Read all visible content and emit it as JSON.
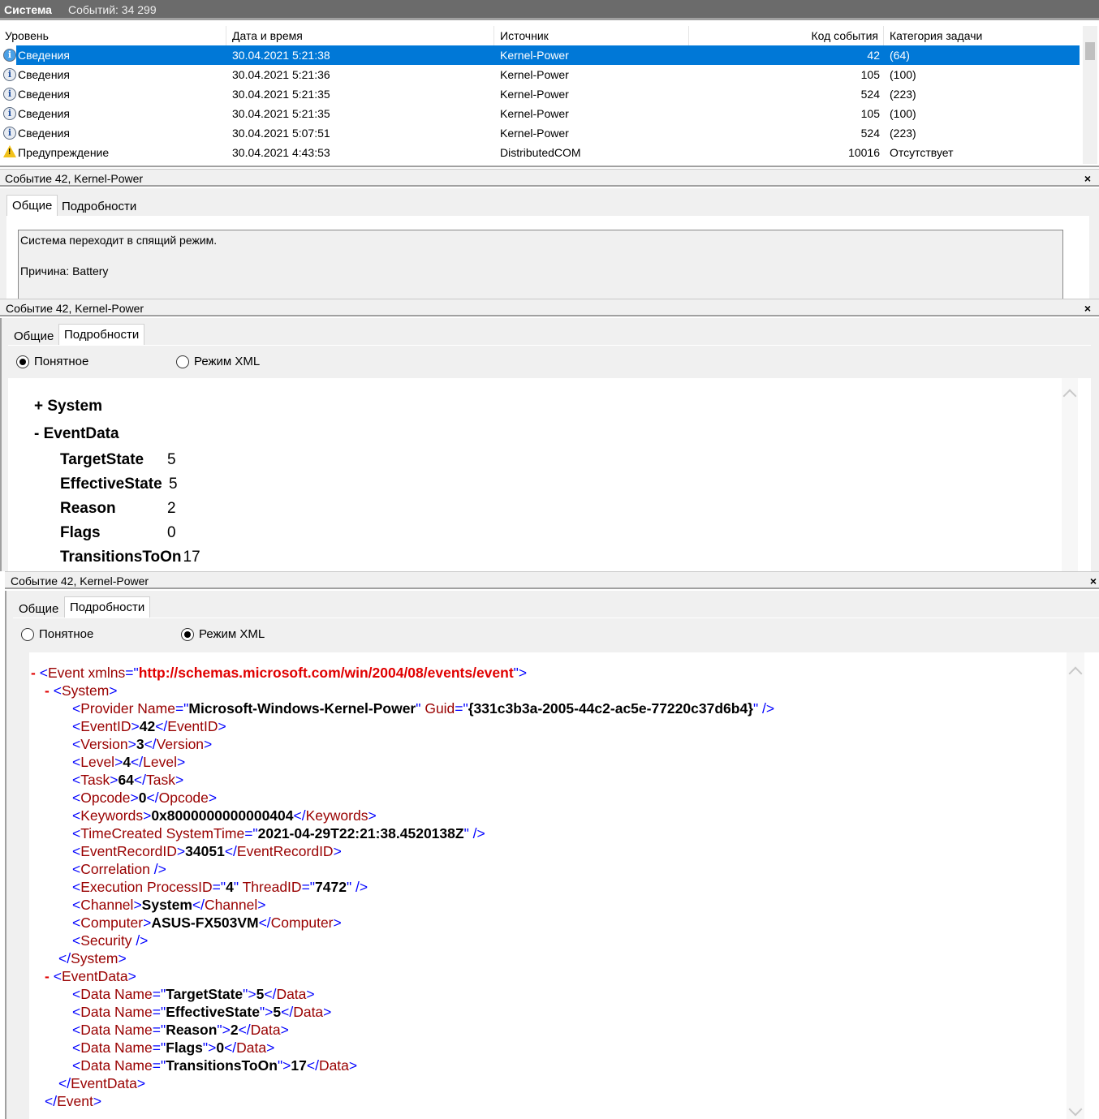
{
  "topbar": {
    "log_name": "Система",
    "event_count": "Событий: 34 299"
  },
  "grid": {
    "columns": [
      "Уровень",
      "Дата и время",
      "Источник",
      "Код события",
      "Категория задачи"
    ],
    "rows": [
      {
        "icon": "info-icon",
        "level": "Сведения",
        "datetime": "30.04.2021 5:21:38",
        "source": "Kernel-Power",
        "code": "42",
        "category": "(64)",
        "selected": true
      },
      {
        "icon": "info-icon",
        "level": "Сведения",
        "datetime": "30.04.2021 5:21:36",
        "source": "Kernel-Power",
        "code": "105",
        "category": "(100)"
      },
      {
        "icon": "info-icon",
        "level": "Сведения",
        "datetime": "30.04.2021 5:21:35",
        "source": "Kernel-Power",
        "code": "524",
        "category": "(223)"
      },
      {
        "icon": "info-icon",
        "level": "Сведения",
        "datetime": "30.04.2021 5:21:35",
        "source": "Kernel-Power",
        "code": "105",
        "category": "(100)"
      },
      {
        "icon": "info-icon",
        "level": "Сведения",
        "datetime": "30.04.2021 5:07:51",
        "source": "Kernel-Power",
        "code": "524",
        "category": "(223)"
      },
      {
        "icon": "warning-icon",
        "level": "Предупреждение",
        "datetime": "30.04.2021 4:43:53",
        "source": "DistributedCOM",
        "code": "10016",
        "category": "Отсутствует"
      }
    ]
  },
  "panel1": {
    "title": "Событие 42, Kernel-Power",
    "close": "×",
    "tabs": [
      "Общие",
      "Подробности"
    ],
    "active_tab": 0,
    "message_line1": "Система переходит в спящий режим.",
    "message_line2": "Причина: Battery"
  },
  "panel2": {
    "title": "Событие 42, Kernel-Power",
    "close": "×",
    "tabs": [
      "Общие",
      "Подробности"
    ],
    "active_tab": 1,
    "radio_friendly": "Понятное",
    "radio_xml": "Режим XML",
    "selected_mode": "friendly",
    "system": "+ System",
    "eventdata": "-  EventData",
    "fields": [
      {
        "k": "TargetState",
        "v": "5"
      },
      {
        "k": "EffectiveState",
        "v": "5"
      },
      {
        "k": "Reason",
        "v": "2"
      },
      {
        "k": "Flags",
        "v": "0"
      },
      {
        "k": "TransitionsToOn",
        "v": "17"
      }
    ]
  },
  "panel3": {
    "title": "Событие 42, Kernel-Power",
    "close": "×",
    "tabs": [
      "Общие",
      "Подробности"
    ],
    "active_tab": 1,
    "radio_friendly": "Понятное",
    "radio_xml": "Режим XML",
    "selected_mode": "xml",
    "xml": [
      {
        "d": 0,
        "s": [
          [
            "m",
            "- "
          ],
          [
            "b",
            "<"
          ],
          [
            "n",
            "Event xmlns"
          ],
          [
            "b",
            "=\""
          ],
          [
            "r",
            "http://schemas.microsoft.com/win/2004/08/events/event"
          ],
          [
            "b",
            "\">"
          ]
        ]
      },
      {
        "d": 1,
        "s": [
          [
            "m",
            "- "
          ],
          [
            "b",
            "<"
          ],
          [
            "n",
            "System"
          ],
          [
            "b",
            ">"
          ]
        ]
      },
      {
        "d": 2,
        "s": [
          [
            "b",
            "<"
          ],
          [
            "n",
            "Provider Name"
          ],
          [
            "b",
            "=\""
          ],
          [
            "v",
            "Microsoft-Windows-Kernel-Power"
          ],
          [
            "b",
            "\" "
          ],
          [
            "n",
            "Guid"
          ],
          [
            "b",
            "=\""
          ],
          [
            "v",
            "{331c3b3a-2005-44c2-ac5e-77220c37d6b4}"
          ],
          [
            "b",
            "\" />"
          ]
        ]
      },
      {
        "d": 2,
        "s": [
          [
            "b",
            "<"
          ],
          [
            "n",
            "EventID"
          ],
          [
            "b",
            ">"
          ],
          [
            "v",
            "42"
          ],
          [
            "b",
            "</"
          ],
          [
            "n",
            "EventID"
          ],
          [
            "b",
            ">"
          ]
        ]
      },
      {
        "d": 2,
        "s": [
          [
            "b",
            "<"
          ],
          [
            "n",
            "Version"
          ],
          [
            "b",
            ">"
          ],
          [
            "v",
            "3"
          ],
          [
            "b",
            "</"
          ],
          [
            "n",
            "Version"
          ],
          [
            "b",
            ">"
          ]
        ]
      },
      {
        "d": 2,
        "s": [
          [
            "b",
            "<"
          ],
          [
            "n",
            "Level"
          ],
          [
            "b",
            ">"
          ],
          [
            "v",
            "4"
          ],
          [
            "b",
            "</"
          ],
          [
            "n",
            "Level"
          ],
          [
            "b",
            ">"
          ]
        ]
      },
      {
        "d": 2,
        "s": [
          [
            "b",
            "<"
          ],
          [
            "n",
            "Task"
          ],
          [
            "b",
            ">"
          ],
          [
            "v",
            "64"
          ],
          [
            "b",
            "</"
          ],
          [
            "n",
            "Task"
          ],
          [
            "b",
            ">"
          ]
        ]
      },
      {
        "d": 2,
        "s": [
          [
            "b",
            "<"
          ],
          [
            "n",
            "Opcode"
          ],
          [
            "b",
            ">"
          ],
          [
            "v",
            "0"
          ],
          [
            "b",
            "</"
          ],
          [
            "n",
            "Opcode"
          ],
          [
            "b",
            ">"
          ]
        ]
      },
      {
        "d": 2,
        "s": [
          [
            "b",
            "<"
          ],
          [
            "n",
            "Keywords"
          ],
          [
            "b",
            ">"
          ],
          [
            "v",
            "0x8000000000000404"
          ],
          [
            "b",
            "</"
          ],
          [
            "n",
            "Keywords"
          ],
          [
            "b",
            ">"
          ]
        ]
      },
      {
        "d": 2,
        "s": [
          [
            "b",
            "<"
          ],
          [
            "n",
            "TimeCreated SystemTime"
          ],
          [
            "b",
            "=\""
          ],
          [
            "v",
            "2021-04-29T22:21:38.4520138Z"
          ],
          [
            "b",
            "\" />"
          ]
        ]
      },
      {
        "d": 2,
        "s": [
          [
            "b",
            "<"
          ],
          [
            "n",
            "EventRecordID"
          ],
          [
            "b",
            ">"
          ],
          [
            "v",
            "34051"
          ],
          [
            "b",
            "</"
          ],
          [
            "n",
            "EventRecordID"
          ],
          [
            "b",
            ">"
          ]
        ]
      },
      {
        "d": 2,
        "s": [
          [
            "b",
            "<"
          ],
          [
            "n",
            "Correlation"
          ],
          [
            "b",
            " />"
          ]
        ]
      },
      {
        "d": 2,
        "s": [
          [
            "b",
            "<"
          ],
          [
            "n",
            "Execution ProcessID"
          ],
          [
            "b",
            "=\""
          ],
          [
            "v",
            "4"
          ],
          [
            "b",
            "\" "
          ],
          [
            "n",
            "ThreadID"
          ],
          [
            "b",
            "=\""
          ],
          [
            "v",
            "7472"
          ],
          [
            "b",
            "\" />"
          ]
        ]
      },
      {
        "d": 2,
        "s": [
          [
            "b",
            "<"
          ],
          [
            "n",
            "Channel"
          ],
          [
            "b",
            ">"
          ],
          [
            "v",
            "System"
          ],
          [
            "b",
            "</"
          ],
          [
            "n",
            "Channel"
          ],
          [
            "b",
            ">"
          ]
        ]
      },
      {
        "d": 2,
        "s": [
          [
            "b",
            "<"
          ],
          [
            "n",
            "Computer"
          ],
          [
            "b",
            ">"
          ],
          [
            "v",
            "ASUS-FX503VM"
          ],
          [
            "b",
            "</"
          ],
          [
            "n",
            "Computer"
          ],
          [
            "b",
            ">"
          ]
        ]
      },
      {
        "d": 2,
        "s": [
          [
            "b",
            "<"
          ],
          [
            "n",
            "Security"
          ],
          [
            "b",
            " />"
          ]
        ]
      },
      {
        "d": 1,
        "s": [
          [
            "b",
            "</"
          ],
          [
            "n",
            "System"
          ],
          [
            "b",
            ">"
          ]
        ]
      },
      {
        "d": 1,
        "s": [
          [
            "m",
            "- "
          ],
          [
            "b",
            "<"
          ],
          [
            "n",
            "EventData"
          ],
          [
            "b",
            ">"
          ]
        ]
      },
      {
        "d": 2,
        "s": [
          [
            "b",
            "<"
          ],
          [
            "n",
            "Data Name"
          ],
          [
            "b",
            "=\""
          ],
          [
            "v",
            "TargetState"
          ],
          [
            "b",
            "\">"
          ],
          [
            "v",
            "5"
          ],
          [
            "b",
            "</"
          ],
          [
            "n",
            "Data"
          ],
          [
            "b",
            ">"
          ]
        ]
      },
      {
        "d": 2,
        "s": [
          [
            "b",
            "<"
          ],
          [
            "n",
            "Data Name"
          ],
          [
            "b",
            "=\""
          ],
          [
            "v",
            "EffectiveState"
          ],
          [
            "b",
            "\">"
          ],
          [
            "v",
            "5"
          ],
          [
            "b",
            "</"
          ],
          [
            "n",
            "Data"
          ],
          [
            "b",
            ">"
          ]
        ]
      },
      {
        "d": 2,
        "s": [
          [
            "b",
            "<"
          ],
          [
            "n",
            "Data Name"
          ],
          [
            "b",
            "=\""
          ],
          [
            "v",
            "Reason"
          ],
          [
            "b",
            "\">"
          ],
          [
            "v",
            "2"
          ],
          [
            "b",
            "</"
          ],
          [
            "n",
            "Data"
          ],
          [
            "b",
            ">"
          ]
        ]
      },
      {
        "d": 2,
        "s": [
          [
            "b",
            "<"
          ],
          [
            "n",
            "Data Name"
          ],
          [
            "b",
            "=\""
          ],
          [
            "v",
            "Flags"
          ],
          [
            "b",
            "\">"
          ],
          [
            "v",
            "0"
          ],
          [
            "b",
            "</"
          ],
          [
            "n",
            "Data"
          ],
          [
            "b",
            ">"
          ]
        ]
      },
      {
        "d": 2,
        "s": [
          [
            "b",
            "<"
          ],
          [
            "n",
            "Data Name"
          ],
          [
            "b",
            "=\""
          ],
          [
            "v",
            "TransitionsToOn"
          ],
          [
            "b",
            "\">"
          ],
          [
            "v",
            "17"
          ],
          [
            "b",
            "</"
          ],
          [
            "n",
            "Data"
          ],
          [
            "b",
            ">"
          ]
        ]
      },
      {
        "d": 1,
        "s": [
          [
            "b",
            "</"
          ],
          [
            "n",
            "EventData"
          ],
          [
            "b",
            ">"
          ]
        ]
      },
      {
        "d": 0,
        "s": [
          [
            "b",
            "</"
          ],
          [
            "n",
            "Event"
          ],
          [
            "b",
            ">"
          ]
        ]
      }
    ]
  },
  "colors": {
    "selection": "#0078d7",
    "xml_bracket": "#0000ff",
    "xml_name": "#990000",
    "xml_marker": "#e00000"
  }
}
